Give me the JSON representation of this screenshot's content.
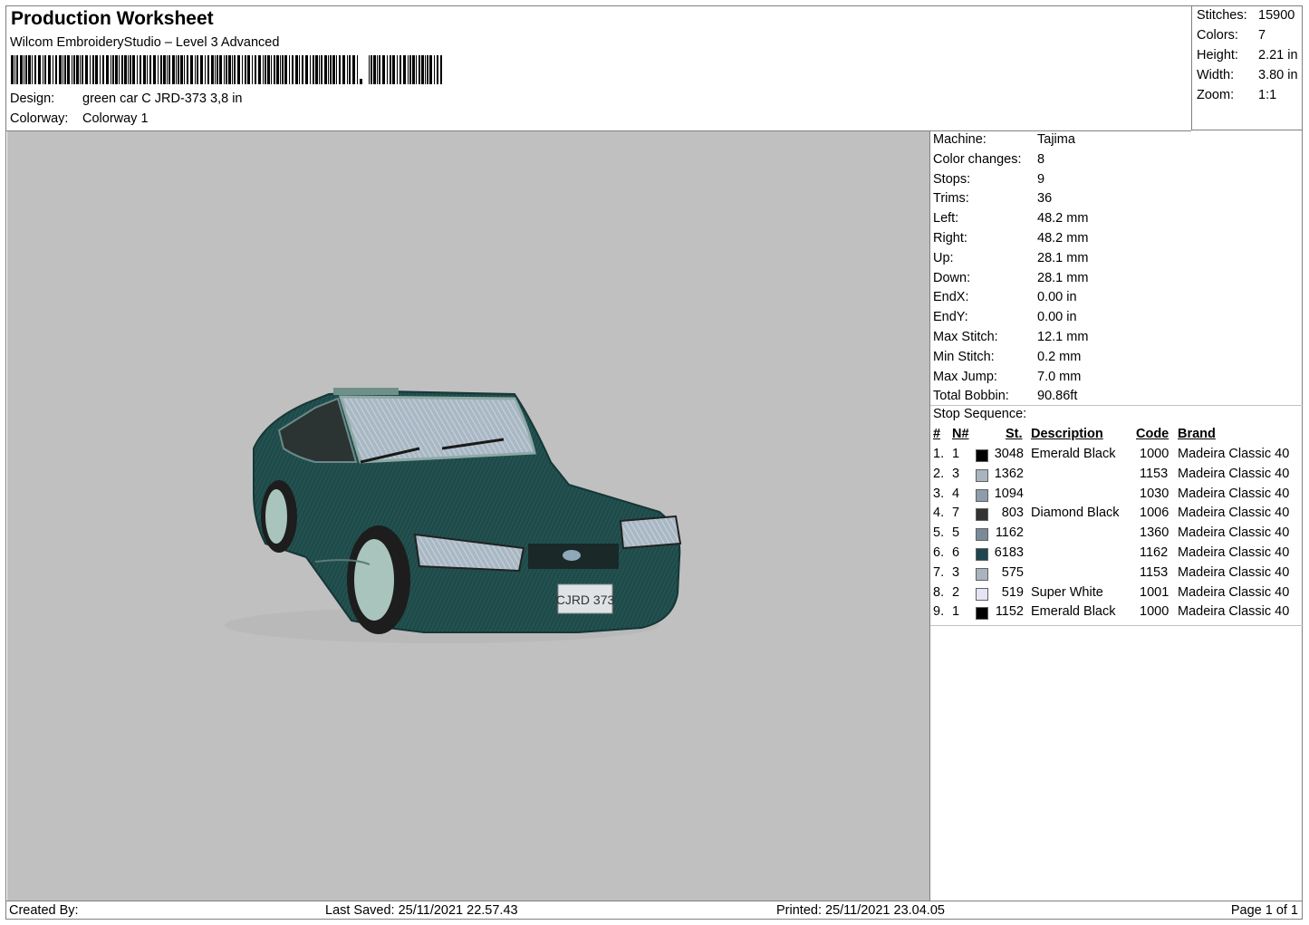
{
  "header": {
    "title": "Production Worksheet",
    "software": "Wilcom EmbroideryStudio – Level 3 Advanced",
    "design_label": "Design:",
    "design_value": "green car C JRD-373 3,8 in",
    "colorway_label": "Colorway:",
    "colorway_value": "Colorway 1"
  },
  "stats": [
    {
      "label": "Stitches:",
      "value": "15900"
    },
    {
      "label": "Colors:",
      "value": "7"
    },
    {
      "label": "Height:",
      "value": "2.21 in"
    },
    {
      "label": "Width:",
      "value": "3.80 in"
    },
    {
      "label": "Zoom:",
      "value": "1:1"
    }
  ],
  "machine_info": [
    {
      "label": "Machine:",
      "value": "Tajima"
    },
    {
      "label": "Color changes:",
      "value": "8"
    },
    {
      "label": "Stops:",
      "value": "9"
    },
    {
      "label": "Trims:",
      "value": "36"
    },
    {
      "label": "Left:",
      "value": "48.2 mm"
    },
    {
      "label": "Right:",
      "value": "48.2 mm"
    },
    {
      "label": "Up:",
      "value": "28.1 mm"
    },
    {
      "label": "Down:",
      "value": "28.1 mm"
    },
    {
      "label": "EndX:",
      "value": "0.00 in"
    },
    {
      "label": "EndY:",
      "value": "0.00 in"
    },
    {
      "label": "Max Stitch:",
      "value": "12.1 mm"
    },
    {
      "label": "Min Stitch:",
      "value": "0.2 mm"
    },
    {
      "label": "Max Jump:",
      "value": "7.0 mm"
    },
    {
      "label": "Total Bobbin:",
      "value": "90.86ft"
    }
  ],
  "stop_sequence": {
    "title": "Stop Sequence:",
    "columns": {
      "num": "#",
      "n": "N#",
      "st": "St.",
      "desc": "Description",
      "code": "Code",
      "brand": "Brand"
    },
    "rows": [
      {
        "num": "1.",
        "n": "1",
        "color": "#000000",
        "st": "3048",
        "desc": "Emerald Black",
        "code": "1000",
        "brand": "Madeira Classic 40"
      },
      {
        "num": "2.",
        "n": "3",
        "color": "#a9b4bf",
        "st": "1362",
        "desc": "",
        "code": "1153",
        "brand": "Madeira Classic 40"
      },
      {
        "num": "3.",
        "n": "4",
        "color": "#8e9cab",
        "st": "1094",
        "desc": "",
        "code": "1030",
        "brand": "Madeira Classic 40"
      },
      {
        "num": "4.",
        "n": "7",
        "color": "#333333",
        "st": "803",
        "desc": "Diamond Black",
        "code": "1006",
        "brand": "Madeira Classic 40"
      },
      {
        "num": "5.",
        "n": "5",
        "color": "#7a8a99",
        "st": "1162",
        "desc": "",
        "code": "1360",
        "brand": "Madeira Classic 40"
      },
      {
        "num": "6.",
        "n": "6",
        "color": "#1f4650",
        "st": "6183",
        "desc": "",
        "code": "1162",
        "brand": "Madeira Classic 40"
      },
      {
        "num": "7.",
        "n": "3",
        "color": "#a9b4bf",
        "st": "575",
        "desc": "",
        "code": "1153",
        "brand": "Madeira Classic 40"
      },
      {
        "num": "8.",
        "n": "2",
        "color": "#e4e4f4",
        "st": "519",
        "desc": "Super White",
        "code": "1001",
        "brand": "Madeira Classic 40"
      },
      {
        "num": "9.",
        "n": "1",
        "color": "#000000",
        "st": "1152",
        "desc": "Emerald Black",
        "code": "1000",
        "brand": "Madeira Classic 40"
      }
    ]
  },
  "preview": {
    "plate_text": "CJRD 373"
  },
  "footer": {
    "created_by": "Created By:",
    "last_saved": "Last Saved: 25/11/2021 22.57.43",
    "printed": "Printed: 25/11/2021 23.04.05",
    "page": "Page 1 of 1"
  }
}
